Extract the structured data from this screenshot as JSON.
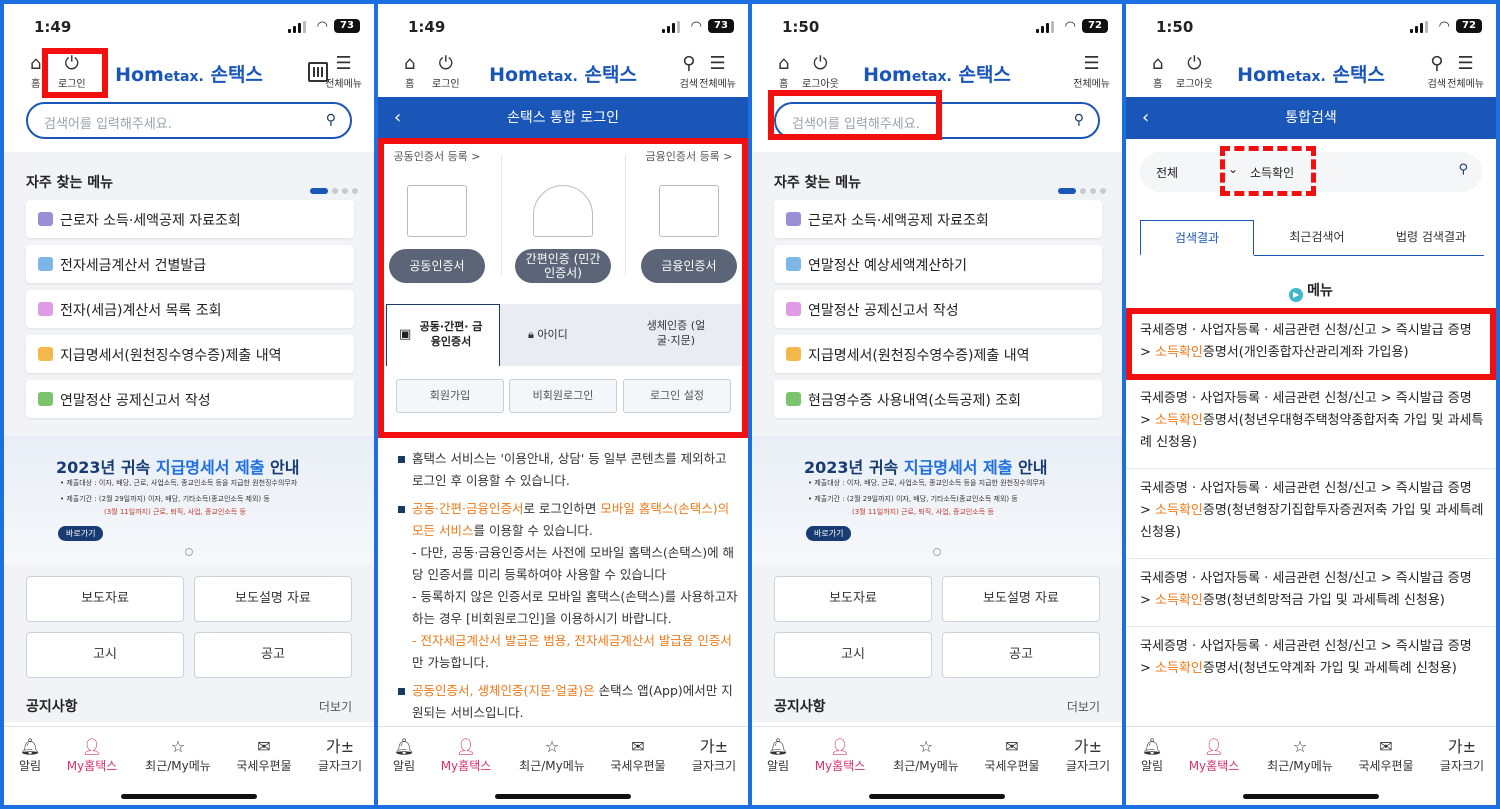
{
  "colors": {
    "accent": "#1a56b8",
    "highlight": "#f10f0f",
    "orange": "#ee7a1a",
    "active_nav": "#d6336c"
  },
  "p1": {
    "time": "1:49",
    "battery": "73",
    "home": "홈",
    "login": "로그인",
    "logo_a": "Hom",
    "logo_b": "etax.",
    "logo_c": "손택스",
    "allmenu": "전체메뉴",
    "search_placeholder": "검색어를 입력해주세요.",
    "fav_title": "자주 찾는 메뉴",
    "items": [
      "근로자 소득·세액공제 자료조회",
      "전자세금계산서 건별발급",
      "전자(세금)계산서 목록 조회",
      "지급명세서(원천징수영수증)제출 내역",
      "연말정산 공제신고서 작성"
    ],
    "banner_a": "2023년 귀속",
    "banner_b": "지급명세서 제출",
    "banner_c": "안내",
    "banner_l1": "• 제출대상 : 이자, 배당, 근로, 사업소득, 종교인소득 등을 지급한 원천징수의무자",
    "banner_l2": "• 제출기간 : (2월 29일까지) 이자, 배당, 기타소득(종교인소득 제외) 등",
    "banner_l3": "(3월 11일까지) 근로, 퇴직, 사업, 종교인소득 등",
    "banner_go": "바로가기",
    "btns": [
      "보도자료",
      "보도설명 자료",
      "고시",
      "공고"
    ],
    "notice": "공지사항",
    "more": "더보기"
  },
  "nav": {
    "alarm": "알림",
    "my": "My홈택스",
    "recent": "최근/My메뉴",
    "mail": "국세우편물",
    "font": "글자크기",
    "font_icon": "가±"
  },
  "p2": {
    "time": "1:49",
    "battery": "73",
    "home": "홈",
    "login": "로그인",
    "search": "검색",
    "allmenu": "전체메뉴",
    "title": "손택스 통합 로그인",
    "cap1": "공동인증서 등록 >",
    "cap3": "금융인증서 등록 >",
    "pill1": "공동인증서",
    "pill2": "간편인증 (민간인증서)",
    "pill3": "금융인증서",
    "tab1": "공동·간편· 금융인증서",
    "tab2": "아이디",
    "tab3": "생체인증 (얼굴·지문)",
    "sb1": "회원가입",
    "sb2": "비회원로그인",
    "sb3": "로그인 설정",
    "b1": "홈택스 서비스는 '이용안내, 상담' 등 일부 콘텐츠를 제외하고 로그인 후 이용할 수 있습니다.",
    "b2o1": "공동·간편·금융인증서",
    "b2t1": "로 로그인하면 ",
    "b2o2": "모바일 홈택스(손택스)의 모든 서비스",
    "b2t2": "를 이용할 수 있습니다.",
    "b2s1": "- 다만, 공동·금융인증서는 사전에 모바일 홈택스(손택스)에 해당 인증서를 미리 등록하여야 사용할 수 있습니다",
    "b2s2": "- 등록하지 않은 인증서로 모바일 홈택스(손택스)를 사용하고자 하는 경우 [비회원로그인]을 이용하시기 바랍니다.",
    "b2s3o": "- 전자세금계산서 발급은 범용, 전자세금계산서 발급용 인증서",
    "b2s3t": "만 가능합니다.",
    "b3o": "공동인증서, 생체인증(지문·얼굴)은",
    "b3t": " 손택스 앱(App)에서만 지원되는 서비스입니다."
  },
  "p3": {
    "time": "1:50",
    "battery": "72",
    "home": "홈",
    "logout": "로그아웃",
    "allmenu": "전체메뉴",
    "search_placeholder": "검색어를 입력해주세요.",
    "fav_title": "자주 찾는 메뉴",
    "items": [
      "근로자 소득·세액공제 자료조회",
      "연말정산 예상세액계산하기",
      "연말정산 공제신고서 작성",
      "지급명세서(원천징수영수증)제출 내역",
      "현금영수증 사용내역(소득공제) 조회"
    ]
  },
  "p4": {
    "time": "1:50",
    "battery": "72",
    "home": "홈",
    "logout": "로그아웃",
    "search": "검색",
    "allmenu": "전체메뉴",
    "title": "통합검색",
    "scope": "전체",
    "query": "소득확인",
    "tabs": [
      "검색결과",
      "최근검색어",
      "법령 검색결과"
    ],
    "menu_h": "메뉴",
    "prefix": "국세증명 · 사업자등록 · 세금관련 신청/신고 > 즉시발급 증명 > ",
    "hl": "소득확인",
    "r1": "증명서(개인종합자산관리계좌 가입용)",
    "r2": "증명서(청년우대형주택청약종합저축 가입 및 과세특례 신청용)",
    "r3": "증명(청년형장기집합투자증권저축 가입 및 과세특례 신청용)",
    "r4": "증명(청년희망적금 가입 및 과세특례 신청용)",
    "r5": "증명서(청년도약계좌 가입 및 과세특례 신청용)"
  }
}
